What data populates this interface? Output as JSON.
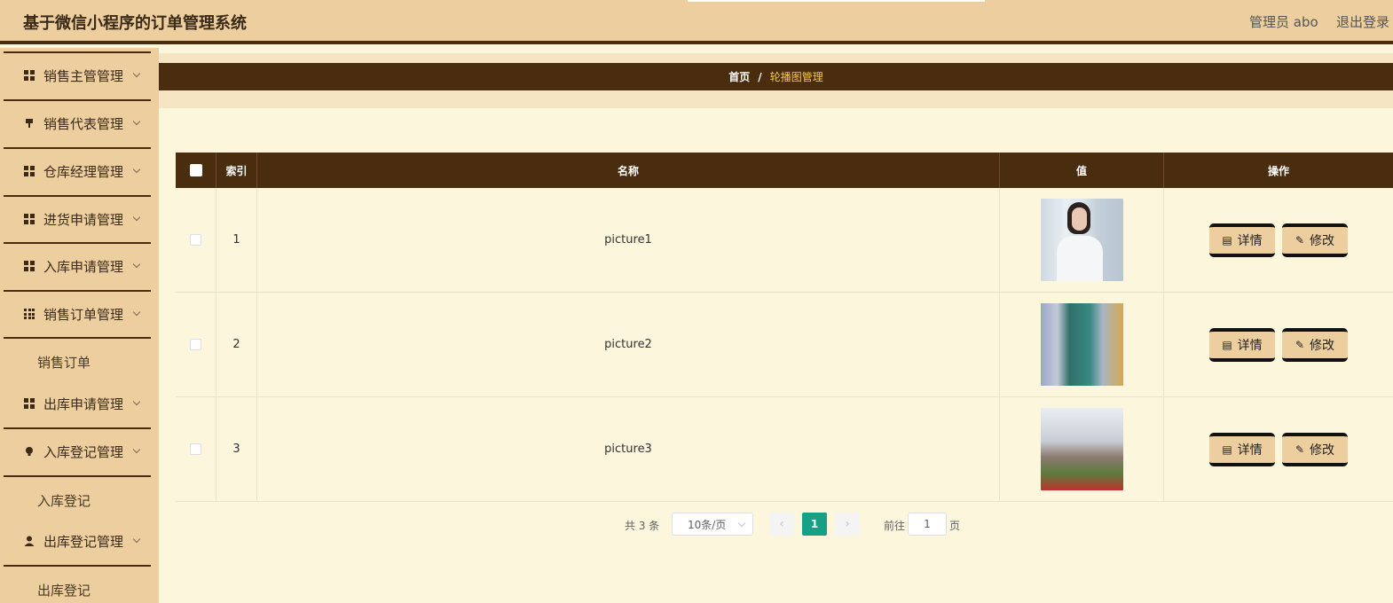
{
  "header": {
    "title": "基于微信小程序的订单管理系统",
    "user": "管理员 abo",
    "logout": "退出登录"
  },
  "sidebar": {
    "items": [
      {
        "label": "销售主管管理",
        "icon": "grid-icon"
      },
      {
        "label": "销售代表管理",
        "icon": "pin-icon"
      },
      {
        "label": "仓库经理管理",
        "icon": "grid-icon"
      },
      {
        "label": "进货申请管理",
        "icon": "grid-icon"
      },
      {
        "label": "入库申请管理",
        "icon": "grid-icon"
      },
      {
        "label": "销售订单管理",
        "icon": "apps-icon"
      },
      {
        "label": "出库申请管理",
        "icon": "grid-icon"
      },
      {
        "label": "入库登记管理",
        "icon": "bulb-icon"
      },
      {
        "label": "出库登记管理",
        "icon": "user-icon"
      }
    ],
    "subitems": {
      "sales_order": "销售订单",
      "in_register": "入库登记",
      "out_register": "出库登记"
    }
  },
  "breadcrumb": {
    "home": "首页",
    "sep": "/",
    "current": "轮播图管理"
  },
  "table": {
    "headers": {
      "index": "索引",
      "name": "名称",
      "value": "值",
      "ops": "操作"
    },
    "rows": [
      {
        "index": "1",
        "name": "picture1"
      },
      {
        "index": "2",
        "name": "picture2"
      },
      {
        "index": "3",
        "name": "picture3"
      }
    ],
    "detail_label": "详情",
    "edit_label": "修改"
  },
  "pagination": {
    "total": "共 3 条",
    "page_size": "10条/页",
    "current_page": "1",
    "goto": "前往",
    "goto_value": "1",
    "unit": "页"
  },
  "colors": {
    "header_bg": "#ecce9f",
    "dark_brown": "#4a2c0f",
    "content_bg": "#fcf6dd",
    "breadcrumb_active": "#f5c84a",
    "page_active": "#16a085"
  }
}
